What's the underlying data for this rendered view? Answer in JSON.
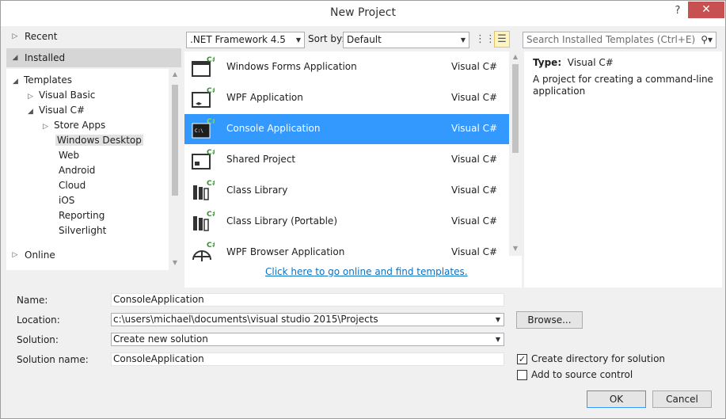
{
  "window": {
    "title": "New Project",
    "help_glyph": "?",
    "close_glyph": "✕"
  },
  "left": {
    "recent": "Recent",
    "installed": "Installed",
    "tree": [
      {
        "label": "Templates",
        "arrow": "◢"
      },
      {
        "label": "Visual Basic",
        "arrow": "▷"
      },
      {
        "label": "Visual C#",
        "arrow": "◢"
      },
      {
        "label": "Store Apps",
        "arrow": "▷"
      },
      {
        "label": "Windows Desktop",
        "arrow": ""
      },
      {
        "label": "Web",
        "arrow": ""
      },
      {
        "label": "Android",
        "arrow": ""
      },
      {
        "label": "Cloud",
        "arrow": ""
      },
      {
        "label": "iOS",
        "arrow": ""
      },
      {
        "label": "Reporting",
        "arrow": ""
      },
      {
        "label": "Silverlight",
        "arrow": ""
      }
    ],
    "online": "Online"
  },
  "toolbar": {
    "framework": ".NET Framework 4.5",
    "sort_label": "Sort by:",
    "sort_value": "Default",
    "search_placeholder": "Search Installed Templates (Ctrl+E)"
  },
  "templates": [
    {
      "name": "Windows Forms Application",
      "lang": "Visual C#",
      "icon": "winforms-icon"
    },
    {
      "name": "WPF Application",
      "lang": "Visual C#",
      "icon": "wpf-icon"
    },
    {
      "name": "Console Application",
      "lang": "Visual C#",
      "icon": "console-icon"
    },
    {
      "name": "Shared Project",
      "lang": "Visual C#",
      "icon": "shared-project-icon"
    },
    {
      "name": "Class Library",
      "lang": "Visual C#",
      "icon": "class-library-icon"
    },
    {
      "name": "Class Library (Portable)",
      "lang": "Visual C#",
      "icon": "portable-library-icon"
    },
    {
      "name": "WPF Browser Application",
      "lang": "Visual C#",
      "icon": "wpf-browser-icon"
    }
  ],
  "online_link": "Click here to go online and find templates.",
  "description": {
    "type_label": "Type:",
    "type_value": "Visual C#",
    "text": "A project for creating a command-line application"
  },
  "form": {
    "name_label": "Name:",
    "name_value": "ConsoleApplication",
    "location_label": "Location:",
    "location_value": "c:\\users\\michael\\documents\\visual studio 2015\\Projects",
    "solution_label": "Solution:",
    "solution_value": "Create new solution",
    "solution_name_label": "Solution name:",
    "solution_name_value": "ConsoleApplication",
    "browse": "Browse...",
    "create_dir": "Create directory for solution",
    "create_dir_checked": true,
    "add_source": "Add to source control",
    "add_source_checked": false,
    "ok": "OK",
    "cancel": "Cancel"
  },
  "colors": {
    "selection": "#3399ff",
    "link": "#0e70c0",
    "close": "#c75050"
  }
}
